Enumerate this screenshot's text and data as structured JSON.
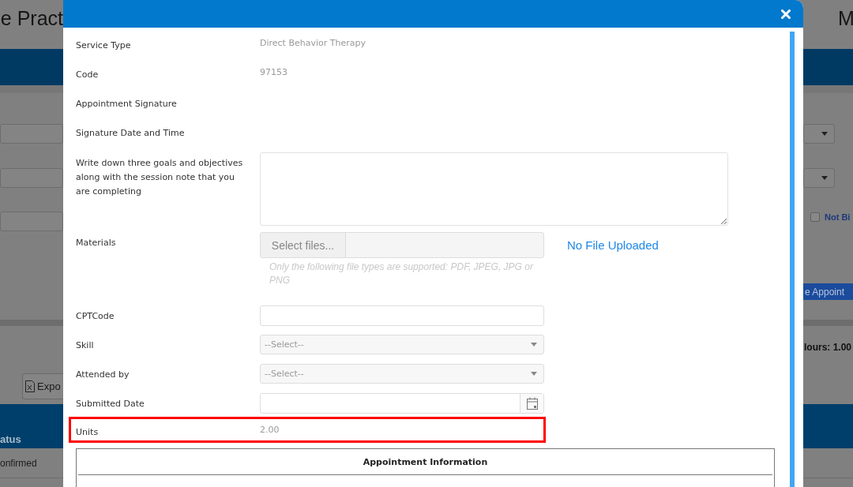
{
  "background": {
    "title": "e Pract",
    "corner_text": "M",
    "export_button": "Expo",
    "column_header": "atus",
    "cell": "onfirmed",
    "checkbox": {
      "label": "Not Bi",
      "checked": false
    },
    "action_button": "e Appoint",
    "hours": "lours: 1.00"
  },
  "fields": [
    {
      "kind": "text",
      "label": "Service Type",
      "value": "Direct Behavior Therapy"
    },
    {
      "kind": "text",
      "label": "Code",
      "value": "97153"
    },
    {
      "kind": "text",
      "label": "Appointment Signature"
    },
    {
      "kind": "text",
      "label": "Signature Date and Time"
    },
    {
      "kind": "textarea",
      "label": "Write down three goals and objectives along with the session note that you are completing"
    },
    {
      "kind": "file",
      "label": "Materials",
      "button": "Select files...",
      "hint": "Only the following file types are supported: PDF, JPEG, JPG or PNG",
      "status": "No File Uploaded"
    },
    {
      "kind": "input",
      "label": "CPTCode"
    },
    {
      "kind": "select",
      "label": "Skill",
      "placeholder": "--Select--"
    },
    {
      "kind": "select",
      "label": "Attended by",
      "placeholder": "--Select--"
    },
    {
      "kind": "date",
      "label": "Submitted Date"
    },
    {
      "kind": "text",
      "label": "Units",
      "value": "2.00",
      "highlighted": true
    }
  ],
  "appointment_info": {
    "title": "Appointment Information"
  }
}
